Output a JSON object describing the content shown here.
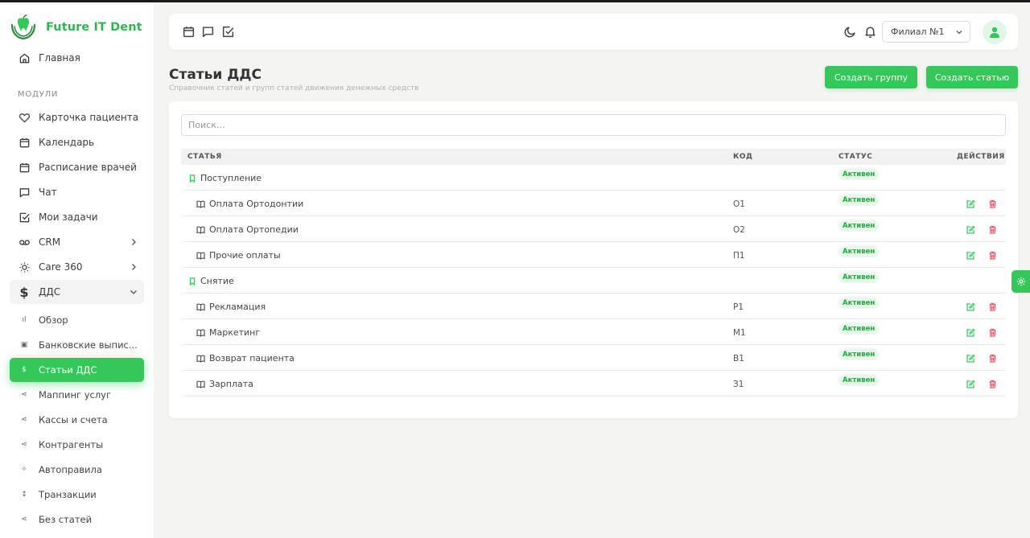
{
  "app": {
    "name": "Future IT Dent"
  },
  "sidebar": {
    "home_label": "Главная",
    "section_label": "МОДУЛИ",
    "modules": [
      {
        "label": "Карточка пациента",
        "icon": "heart-icon"
      },
      {
        "label": "Календарь",
        "icon": "calendar-icon"
      },
      {
        "label": "Расписание врачей",
        "icon": "calendar-icon"
      },
      {
        "label": "Чат",
        "icon": "chat-icon"
      },
      {
        "label": "Мои задачи",
        "icon": "checkbox-icon"
      },
      {
        "label": "CRM",
        "icon": "voicemail-icon"
      },
      {
        "label": "Care 360",
        "icon": "sun-icon"
      },
      {
        "label": "ДДС",
        "icon": "dollar-icon"
      }
    ],
    "dds_children": [
      {
        "label": "Обзор",
        "glyph": "ıl"
      },
      {
        "label": "Банковские выпис...",
        "glyph": "▣"
      },
      {
        "label": "Статьи ДДС",
        "glyph": "$"
      },
      {
        "label": "Маппинг услуг",
        "glyph": "⋖"
      },
      {
        "label": "Кассы и счета",
        "glyph": "⋖"
      },
      {
        "label": "Контрагенты",
        "glyph": "⋖"
      },
      {
        "label": "Автоправила",
        "glyph": "✧"
      },
      {
        "label": "Транзакции",
        "glyph": "↕"
      },
      {
        "label": "Без статей",
        "glyph": "⋖"
      }
    ]
  },
  "topbar": {
    "branch": "Филиал №1"
  },
  "page": {
    "title": "Статьи ДДС",
    "subtitle": "Справочник статей и групп статей движения денежных средств",
    "create_group": "Создать группу",
    "create_article": "Создать статью"
  },
  "search": {
    "placeholder": "Поиск..."
  },
  "table": {
    "headers": {
      "article": "СТАТЬЯ",
      "code": "КОД",
      "status": "СТАТУС",
      "actions": "ДЕЙСТВИЯ"
    },
    "rows": [
      {
        "name": "Поступление",
        "code": "",
        "status": "Активен",
        "group": true
      },
      {
        "name": "Оплата Ортодонтии",
        "code": "О1",
        "status": "Активен",
        "group": false
      },
      {
        "name": "Оплата Ортопедии",
        "code": "О2",
        "status": "Активен",
        "group": false
      },
      {
        "name": "Прочие оплаты",
        "code": "П1",
        "status": "Активен",
        "group": false
      },
      {
        "name": "Снятие",
        "code": "",
        "status": "Активен",
        "group": true
      },
      {
        "name": "Рекламация",
        "code": "Р1",
        "status": "Активен",
        "group": false
      },
      {
        "name": "Маркетинг",
        "code": "М1",
        "status": "Активен",
        "group": false
      },
      {
        "name": "Возврат пациента",
        "code": "В1",
        "status": "Активен",
        "group": false
      },
      {
        "name": "Зарплата",
        "code": "З1",
        "status": "Активен",
        "group": false
      }
    ]
  },
  "colors": {
    "accent": "#34c759",
    "brand_text": "#2fb553",
    "danger": "#e05563"
  }
}
